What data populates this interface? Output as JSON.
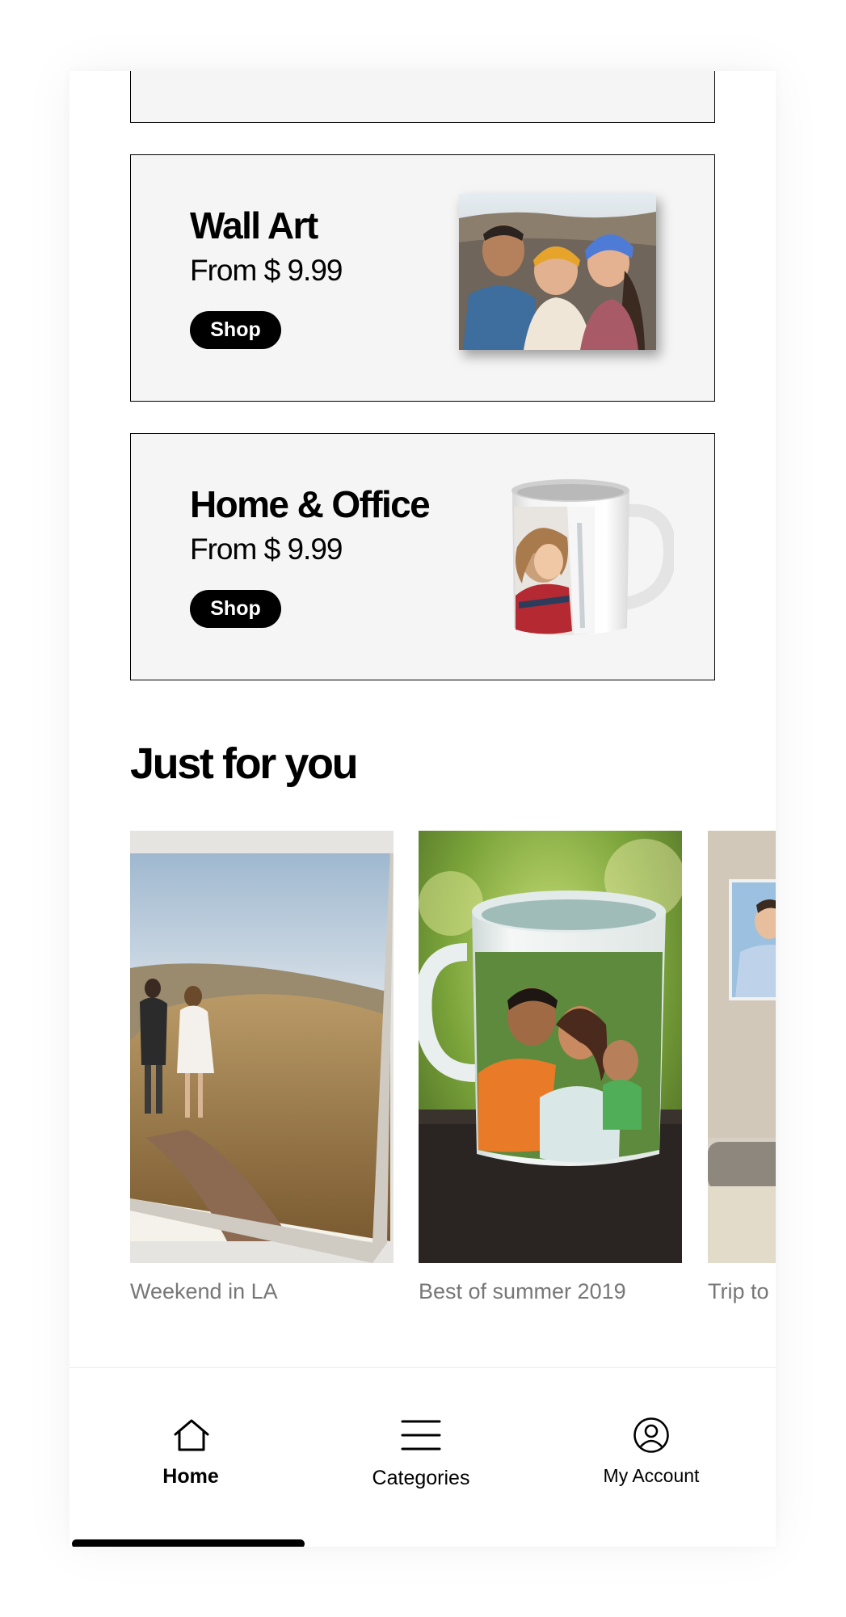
{
  "categories": [
    {
      "title": "Wall Art",
      "price": "From $ 9.99",
      "cta": "Shop"
    },
    {
      "title": "Home & Office",
      "price": "From $ 9.99",
      "cta": "Shop"
    }
  ],
  "recommendations": {
    "title": "Just for you",
    "items": [
      {
        "label": "Weekend in LA"
      },
      {
        "label": "Best of summer 2019"
      },
      {
        "label": "Trip to"
      }
    ]
  },
  "tabbar": {
    "items": [
      {
        "label": "Home",
        "icon": "house-icon",
        "active": true
      },
      {
        "label": "Categories",
        "icon": "menu-icon",
        "active": false
      },
      {
        "label": "My Account",
        "icon": "user-circle-icon",
        "active": false
      }
    ]
  }
}
